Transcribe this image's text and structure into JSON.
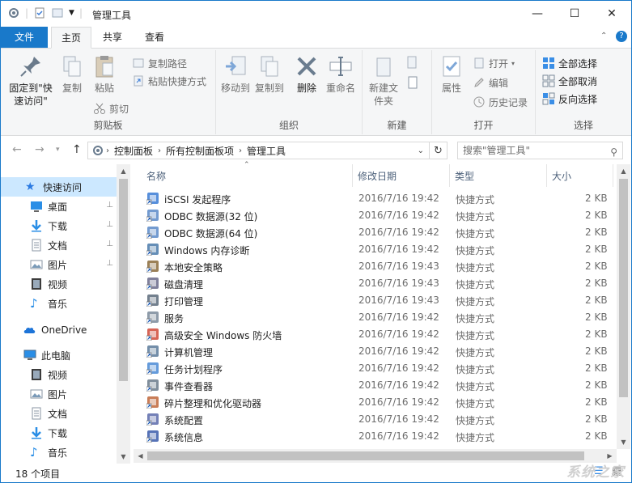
{
  "window": {
    "title": "管理工具",
    "minimize_glyph": "—",
    "maximize_glyph": "☐",
    "close_glyph": "✕"
  },
  "tabs": {
    "file": "文件",
    "home": "主页",
    "share": "共享",
    "view": "查看"
  },
  "ribbon": {
    "clipboard": {
      "label": "剪贴板",
      "pin": "固定到\"快速访问\"",
      "copy": "复制",
      "paste": "粘贴",
      "copy_path": "复制路径",
      "paste_shortcut": "粘贴快捷方式",
      "cut": "剪切"
    },
    "organize": {
      "label": "组织",
      "move_to": "移动到",
      "copy_to": "复制到",
      "delete": "删除",
      "rename": "重命名"
    },
    "new": {
      "label": "新建",
      "new_folder": "新建文件夹"
    },
    "open": {
      "label": "打开",
      "properties": "属性",
      "open": "打开",
      "edit": "编辑",
      "history": "历史记录"
    },
    "select": {
      "label": "选择",
      "select_all": "全部选择",
      "select_none": "全部取消",
      "invert": "反向选择"
    }
  },
  "address": {
    "crumbs": [
      "控制面板",
      "所有控制面板项",
      "管理工具"
    ],
    "search_placeholder": "搜索\"管理工具\""
  },
  "nav": {
    "quick_access": "快速访问",
    "quick_items": [
      "桌面",
      "下载",
      "文档",
      "图片",
      "视频",
      "音乐"
    ],
    "onedrive": "OneDrive",
    "this_pc": "此电脑",
    "pc_items": [
      "视频",
      "图片",
      "文档",
      "下载",
      "音乐"
    ]
  },
  "columns": {
    "name": "名称",
    "date": "修改日期",
    "type": "类型",
    "size": "大小"
  },
  "files": [
    {
      "name": "iSCSI 发起程序",
      "date": "2016/7/16 19:42",
      "type": "快捷方式",
      "size": "2 KB"
    },
    {
      "name": "ODBC 数据源(32 位)",
      "date": "2016/7/16 19:42",
      "type": "快捷方式",
      "size": "2 KB"
    },
    {
      "name": "ODBC 数据源(64 位)",
      "date": "2016/7/16 19:42",
      "type": "快捷方式",
      "size": "2 KB"
    },
    {
      "name": "Windows 内存诊断",
      "date": "2016/7/16 19:42",
      "type": "快捷方式",
      "size": "2 KB"
    },
    {
      "name": "本地安全策略",
      "date": "2016/7/16 19:43",
      "type": "快捷方式",
      "size": "2 KB"
    },
    {
      "name": "磁盘清理",
      "date": "2016/7/16 19:43",
      "type": "快捷方式",
      "size": "2 KB"
    },
    {
      "name": "打印管理",
      "date": "2016/7/16 19:43",
      "type": "快捷方式",
      "size": "2 KB"
    },
    {
      "name": "服务",
      "date": "2016/7/16 19:42",
      "type": "快捷方式",
      "size": "2 KB"
    },
    {
      "name": "高级安全 Windows 防火墙",
      "date": "2016/7/16 19:42",
      "type": "快捷方式",
      "size": "2 KB"
    },
    {
      "name": "计算机管理",
      "date": "2016/7/16 19:42",
      "type": "快捷方式",
      "size": "2 KB"
    },
    {
      "name": "任务计划程序",
      "date": "2016/7/16 19:42",
      "type": "快捷方式",
      "size": "2 KB"
    },
    {
      "name": "事件查看器",
      "date": "2016/7/16 19:42",
      "type": "快捷方式",
      "size": "2 KB"
    },
    {
      "name": "碎片整理和优化驱动器",
      "date": "2016/7/16 19:42",
      "type": "快捷方式",
      "size": "2 KB"
    },
    {
      "name": "系统配置",
      "date": "2016/7/16 19:42",
      "type": "快捷方式",
      "size": "2 KB"
    },
    {
      "name": "系统信息",
      "date": "2016/7/16 19:42",
      "type": "快捷方式",
      "size": "2 KB"
    }
  ],
  "status": {
    "item_count": "18 个项目",
    "watermark": "系统之家"
  },
  "colors": {
    "accent": "#1979ca",
    "selected_bg": "#cce8ff",
    "ribbon_bg": "#f5f6f7"
  }
}
